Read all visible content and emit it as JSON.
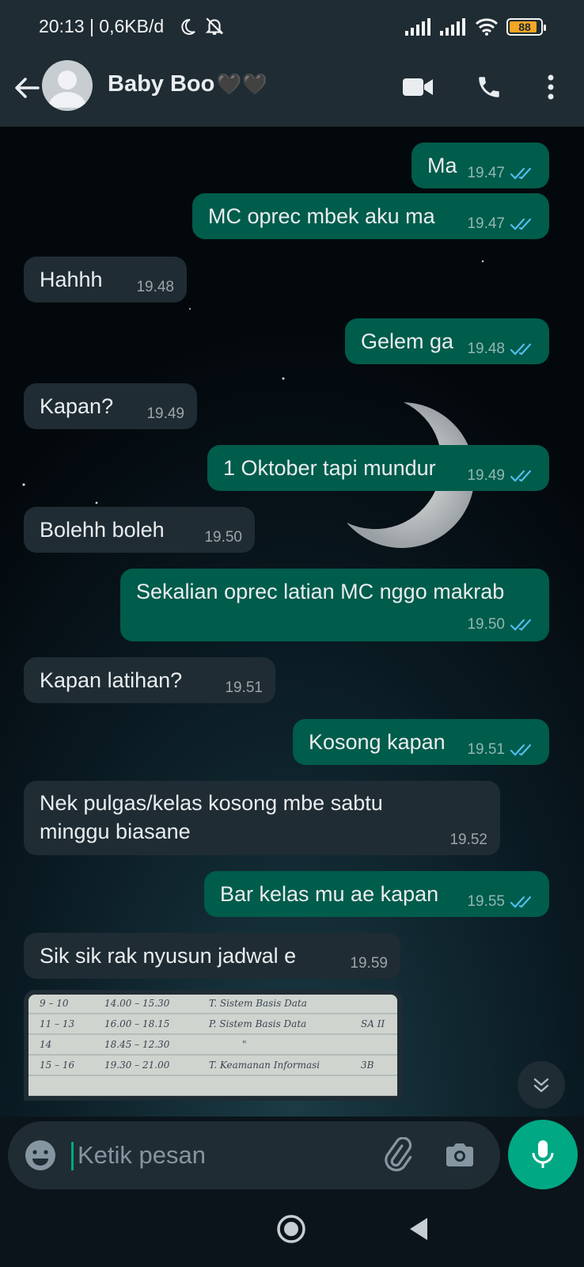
{
  "status_bar": {
    "time": "20:13 | 0,6KB/d",
    "battery": "88",
    "icons": [
      "moon-icon",
      "bell-off-icon",
      "signal-icon",
      "signal-icon",
      "wifi-icon",
      "battery-icon"
    ]
  },
  "header": {
    "contact_name": "Baby Boo",
    "name_emoji": "🖤🖤",
    "icons": [
      "back-arrow-icon",
      "avatar",
      "video-call-icon",
      "phone-icon",
      "more-icon"
    ]
  },
  "messages": [
    {
      "dir": "out",
      "text": "Ma",
      "time": "19.47"
    },
    {
      "dir": "out",
      "text": "MC oprec mbek aku ma",
      "time": "19.47"
    },
    {
      "dir": "in",
      "text": "Hahhh",
      "time": "19.48"
    },
    {
      "dir": "out",
      "text": "Gelem ga",
      "time": "19.48"
    },
    {
      "dir": "in",
      "text": "Kapan?",
      "time": "19.49"
    },
    {
      "dir": "out",
      "text": "1 Oktober tapi mundur",
      "time": "19.49"
    },
    {
      "dir": "in",
      "text": "Bolehh boleh",
      "time": "19.50"
    },
    {
      "dir": "out",
      "text": "Sekalian oprec latian MC nggo makrab",
      "time": "19.50"
    },
    {
      "dir": "in",
      "text": "Kapan latihan?",
      "time": "19.51"
    },
    {
      "dir": "out",
      "text": "Kosong kapan",
      "time": "19.51"
    },
    {
      "dir": "in",
      "text": "Nek pulgas/kelas kosong mbe sabtu\nminggu biasane",
      "time": "19.52"
    },
    {
      "dir": "out",
      "text": "Bar kelas mu ae kapan",
      "time": "19.55"
    },
    {
      "dir": "in",
      "text": "Sik sik rak nyusun jadwal e",
      "time": "19.59"
    }
  ],
  "image_message": {
    "rows": [
      {
        "a": "9 – 10",
        "b": "14.00 – 15.30",
        "c": "T. Sistem Basis Data",
        "d": ""
      },
      {
        "a": "11 – 13",
        "b": "16.00 – 18.15",
        "c": "P. Sistem Basis Data",
        "d": "SA II"
      },
      {
        "a": "14",
        "b": "18.45 – 12.30",
        "c": "\"",
        "d": ""
      },
      {
        "a": "15 – 16",
        "b": "19.30 – 21.00",
        "c": "T. Keamanan Informasi",
        "d": "3B"
      }
    ]
  },
  "composer": {
    "placeholder": "Ketik pesan"
  },
  "colors": {
    "incoming_bubble": "#1f2c34",
    "outgoing_bubble": "#005c4b",
    "accent": "#00a884",
    "read_ticks": "#53bdeb"
  }
}
